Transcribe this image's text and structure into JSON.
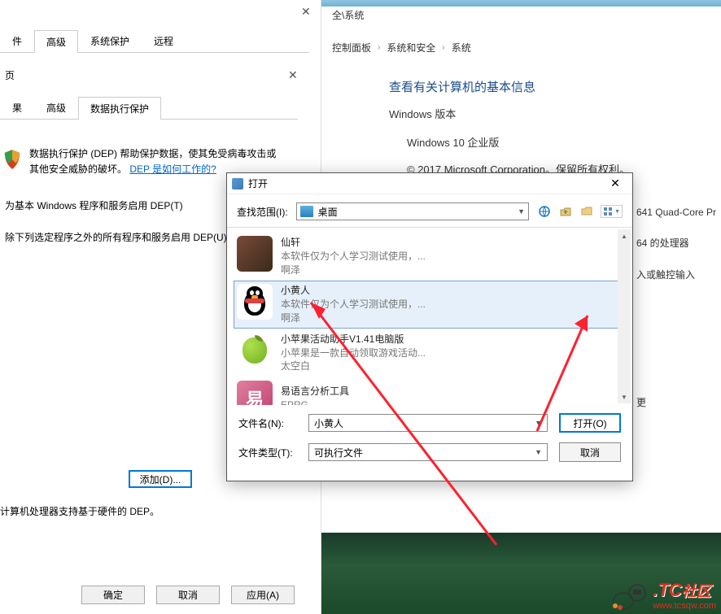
{
  "bgRight": {
    "titlebar": "全\\系统",
    "breadcrumb": [
      "控制面板",
      "系统和安全",
      "系统"
    ],
    "infoTitle": "查看有关计算机的基本信息",
    "versionHdr": "Windows 版本",
    "version": "Windows 10 企业版",
    "copyright": "© 2017 Microsoft Corporation。保留所有权利。",
    "specs": [
      "641 Quad-Core Pr",
      "64 的处理器",
      "入或触控输入",
      "更"
    ]
  },
  "bgLeft": {
    "tabs1": [
      "件",
      "高级",
      "系统保护",
      "远程"
    ],
    "tabs1Active": 1,
    "subHdr": "页",
    "tabs2": [
      "果",
      "高级",
      "数据执行保护"
    ],
    "tabs2Active": 2,
    "depDesc1": "数据执行保护 (DEP) 帮助保护数据，使其免受病毒攻击或其他安全威胁的破坏。",
    "depLink": "DEP 是如何工作的?",
    "radio1": "为基本 Windows 程序和服务启用 DEP(T)",
    "radio2": "除下列选定程序之外的所有程序和服务启用 DEP(U)",
    "addBtn": "添加(D)...",
    "depNote": "计算机处理器支持基于硬件的 DEP。",
    "ok": "确定",
    "cancel": "取消",
    "apply": "应用(A)"
  },
  "dialog": {
    "title": "打开",
    "lookinLabel": "查找范围(I):",
    "lookinValue": "桌面",
    "files": [
      {
        "name": "仙轩",
        "desc": "本软件仅为个人学习测试使用，...",
        "author": "啊泽"
      },
      {
        "name": "小黄人",
        "desc": "本软件仅为个人学习测试使用，...",
        "author": "啊泽"
      },
      {
        "name": "小苹果活动助手V1.41电脑版",
        "desc": "小苹果是一款自动领取游戏活动...",
        "author": "太空白"
      },
      {
        "name": "易语言分析工具",
        "desc": "EPRG",
        "author": ""
      }
    ],
    "selected": 1,
    "fileNameLabel": "文件名(N):",
    "fileNameValue": "小黄人",
    "fileTypeLabel": "文件类型(T):",
    "fileTypeValue": "可执行文件",
    "openBtn": "打开(O)",
    "cancelBtn": "取消"
  },
  "watermark": {
    "brand": ".TC",
    "brand2": "社区",
    "url": "www.tcsqw.com"
  }
}
